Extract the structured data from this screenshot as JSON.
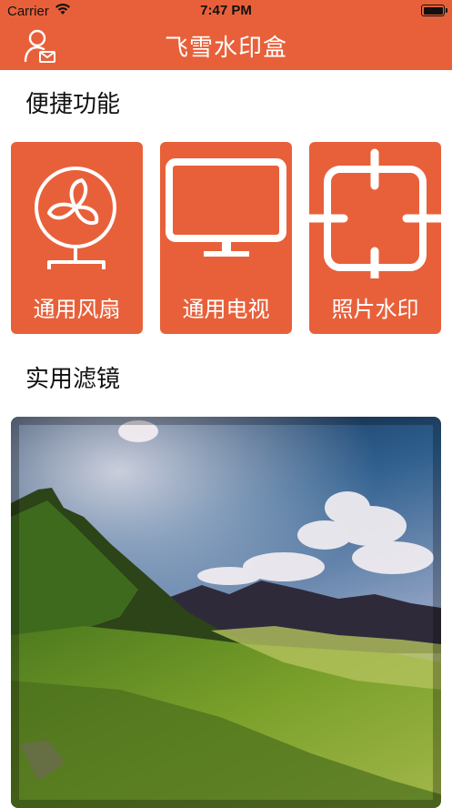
{
  "status_bar": {
    "carrier": "Carrier",
    "time": "7:47 PM",
    "wifi_icon": "wifi-icon",
    "battery_icon": "battery-icon"
  },
  "nav": {
    "title": "飞雪水印盒",
    "user_icon": "user-mail-icon"
  },
  "sections": {
    "quick": "便捷功能",
    "filters": "实用滤镜"
  },
  "tiles": [
    {
      "label": "通用风扇",
      "icon": "fan-icon"
    },
    {
      "label": "通用电视",
      "icon": "monitor-icon"
    },
    {
      "label": "照片水印",
      "icon": "crop-frame-icon"
    }
  ],
  "colors": {
    "accent": "#E8603A",
    "white": "#FFFFFF"
  }
}
